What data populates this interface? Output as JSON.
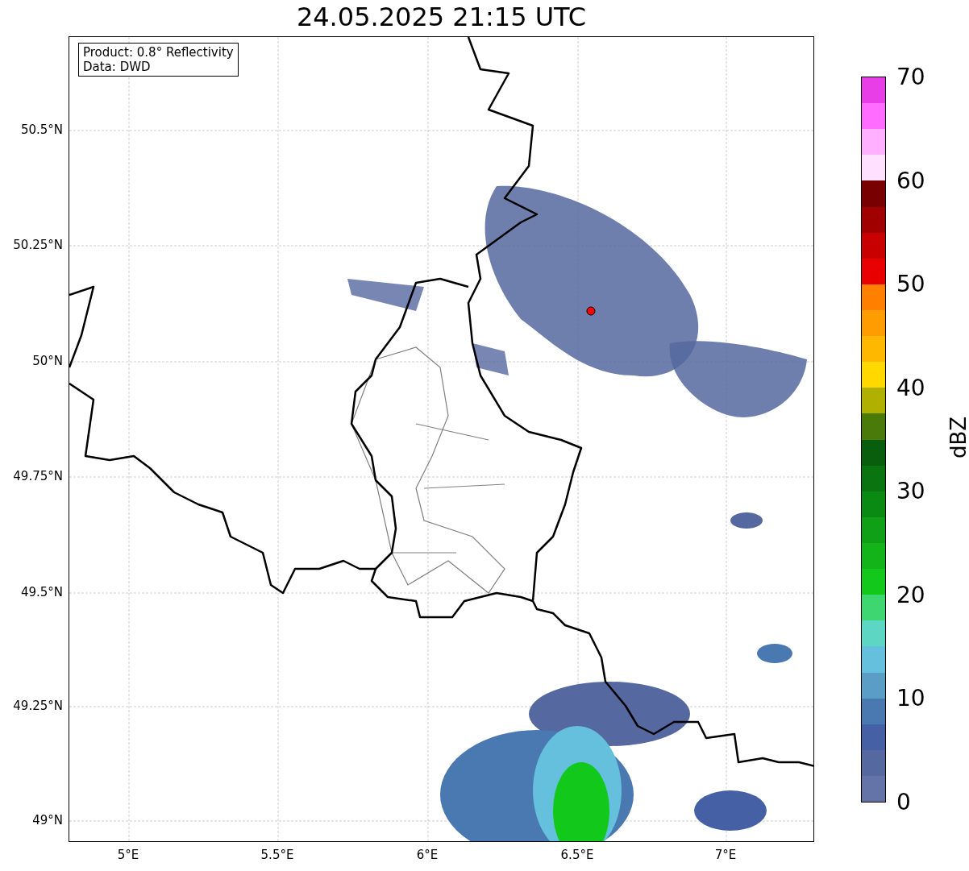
{
  "title": "24.05.2025 21:15 UTC",
  "annotation": [
    "Product: 0.8° Reflectivity",
    "Data: DWD"
  ],
  "y_ticks": [
    "50.5°N",
    "50.25°N",
    "50°N",
    "49.75°N",
    "49.5°N",
    "49.25°N",
    "49°N"
  ],
  "x_ticks": [
    "5°E",
    "5.5°E",
    "6°E",
    "6.5°E",
    "7°E"
  ],
  "colorbar": {
    "label": "dBZ",
    "ticks": [
      "70",
      "60",
      "50",
      "40",
      "30",
      "20",
      "10",
      "0"
    ],
    "segments": [
      {
        "color": "#e83ee8"
      },
      {
        "color": "#ff6cff"
      },
      {
        "color": "#ffb0ff"
      },
      {
        "color": "#ffe0ff"
      },
      {
        "color": "#780000"
      },
      {
        "color": "#a00000"
      },
      {
        "color": "#c80000"
      },
      {
        "color": "#e80000"
      },
      {
        "color": "#ff7f00"
      },
      {
        "color": "#ff9c00"
      },
      {
        "color": "#ffb800"
      },
      {
        "color": "#ffd800"
      },
      {
        "color": "#b0b000"
      },
      {
        "color": "#4a7a0a"
      },
      {
        "color": "#085e0c"
      },
      {
        "color": "#0a7410"
      },
      {
        "color": "#0a8a12"
      },
      {
        "color": "#10a018"
      },
      {
        "color": "#12b41a"
      },
      {
        "color": "#12c81a"
      },
      {
        "color": "#3dd670"
      },
      {
        "color": "#5ed6c4"
      },
      {
        "color": "#64c0dc"
      },
      {
        "color": "#5a9ec5"
      },
      {
        "color": "#4a78b0"
      },
      {
        "color": "#4560a5"
      },
      {
        "color": "#5568a0"
      },
      {
        "color": "#6473a8"
      }
    ]
  }
}
